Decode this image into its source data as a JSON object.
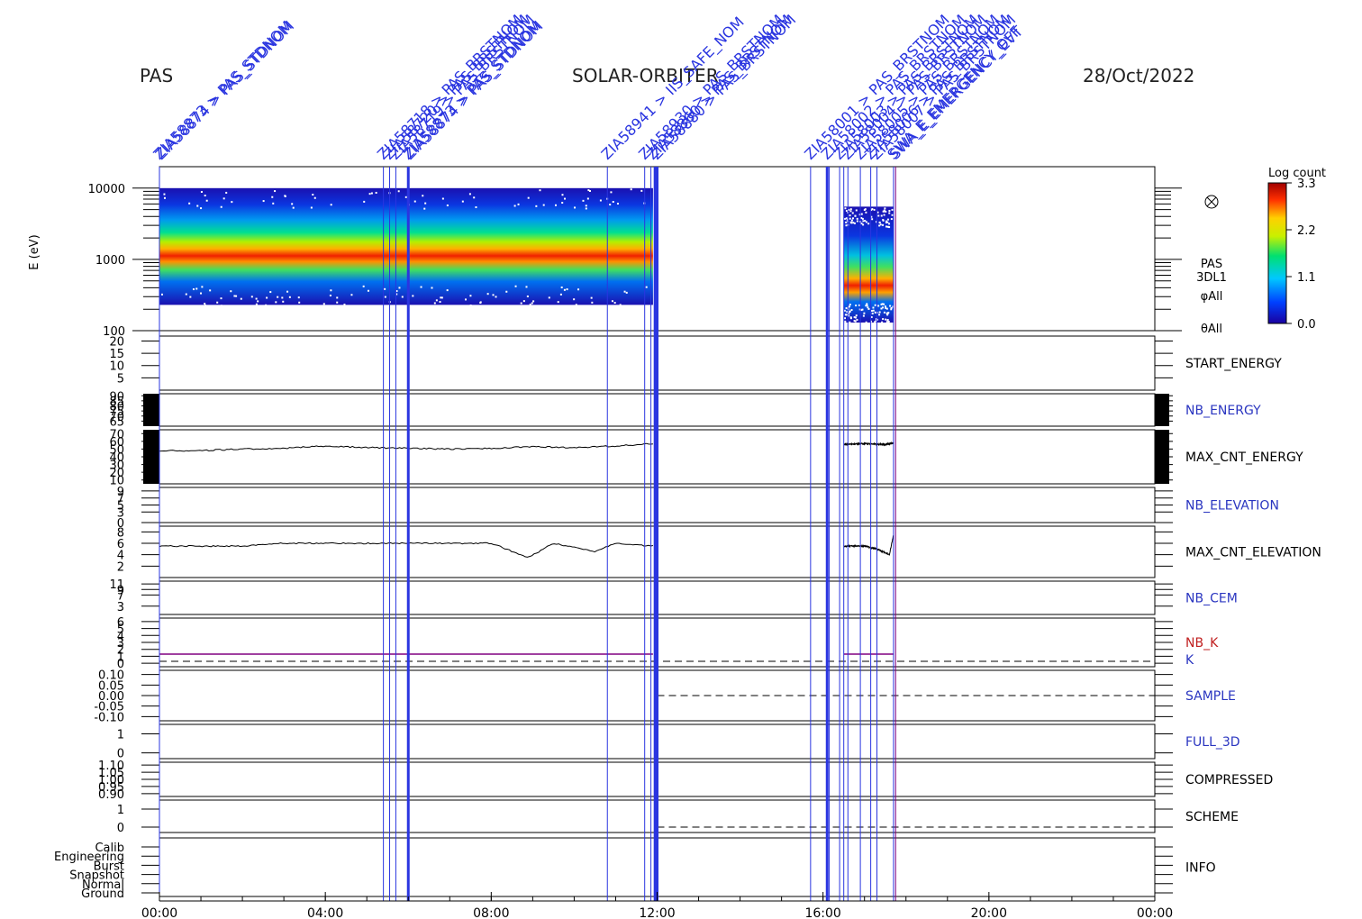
{
  "header": {
    "instrument": "PAS",
    "mission": "SOLAR-ORBITER",
    "date": "28/Oct/2022"
  },
  "chart_data": {
    "type": "heatmap",
    "title": "",
    "xlabel": "",
    "x_ticks": [
      "00:00",
      "04:00",
      "08:00",
      "12:00",
      "16:00",
      "20:00",
      "00:00"
    ],
    "x_range_hours": [
      0,
      24
    ],
    "spectrogram": {
      "ylabel": "E (eV)",
      "y_scale": "log",
      "ylim": [
        100,
        20000
      ],
      "y_ticks": [
        "10000",
        "1000",
        "100"
      ],
      "colorbar": {
        "title": "Log count",
        "ticks": [
          "3.3",
          "2.2",
          "1.1",
          "0.0"
        ],
        "range": [
          0.0,
          3.3
        ]
      },
      "side_labels": [
        "PAS",
        "3DL1",
        "φAll",
        "θAll"
      ],
      "data_intervals_hours": [
        [
          0.0,
          11.9
        ],
        [
          16.5,
          17.7
        ]
      ],
      "peak_energy_eV_approx": 1000,
      "coverage_energy_eV": [
        230,
        10000
      ]
    },
    "panels": [
      {
        "name": "START_ENERGY",
        "color": "#000000",
        "y_ticks": [
          "20",
          "15",
          "10",
          "5"
        ],
        "ylim": [
          0,
          22
        ]
      },
      {
        "name": "NB_ENERGY",
        "color": "#2a35c0",
        "y_ticks": [
          "90",
          "85",
          "80",
          "75",
          "70",
          "65"
        ],
        "ylim": [
          60,
          92
        ]
      },
      {
        "name": "MAX_CNT_ENERGY",
        "color": "#000000",
        "y_ticks": [
          "70",
          "60",
          "50",
          "40",
          "30",
          "20",
          "10"
        ],
        "ylim": [
          5,
          75
        ],
        "series": [
          {
            "x": [
              0.0,
              1.0,
              2.0,
              3.0,
              4.0,
              5.0,
              6.0,
              7.0,
              8.0,
              9.0,
              10.0,
              11.0,
              11.9
            ],
            "values": [
              48,
              48,
              50,
              51,
              54,
              52,
              51,
              50,
              51,
              53,
              52,
              54,
              57
            ]
          },
          {
            "x": [
              16.5,
              17.0,
              17.5,
              17.7
            ],
            "values": [
              56,
              57,
              56,
              58
            ]
          }
        ]
      },
      {
        "name": "NB_ELEVATION",
        "color": "#2a35c0",
        "y_ticks": [
          "9",
          "7",
          "5",
          "3",
          "0"
        ],
        "ylim": [
          0,
          10
        ]
      },
      {
        "name": "MAX_CNT_ELEVATION",
        "color": "#000000",
        "y_ticks": [
          "8",
          "6",
          "4",
          "2"
        ],
        "ylim": [
          0,
          9
        ],
        "series": [
          {
            "x": [
              0.0,
              2.0,
              3.0,
              5.0,
              6.0,
              8.0,
              8.9,
              9.5,
              10.5,
              11.0,
              11.9
            ],
            "values": [
              5.5,
              5.5,
              6.0,
              6.0,
              6.0,
              6.0,
              3.5,
              6.0,
              4.5,
              6.0,
              5.5
            ]
          },
          {
            "x": [
              16.5,
              17.0,
              17.3,
              17.6,
              17.7
            ],
            "values": [
              5.5,
              5.5,
              5.0,
              4.0,
              7.5
            ]
          }
        ]
      },
      {
        "name": "NB_CEM",
        "color": "#2a35c0",
        "y_ticks": [
          "11",
          "9",
          "7",
          "3"
        ],
        "ylim": [
          0,
          12
        ]
      },
      {
        "name": "NB_K",
        "color": "#c02020",
        "y_ticks": [
          "6",
          "5",
          "4",
          "3",
          "2",
          "1",
          "0"
        ],
        "ylim": [
          -0.5,
          6.5
        ]
      },
      {
        "name": "SAMPLE",
        "color": "#2a35c0",
        "y_ticks": [
          "0.10",
          "0.05",
          "0.00",
          "-0.05",
          "-0.10"
        ],
        "ylim": [
          -0.12,
          0.12
        ]
      },
      {
        "name": "FULL_3D",
        "color": "#2a35c0",
        "y_ticks": [
          "1",
          "0"
        ],
        "ylim": [
          -0.3,
          1.5
        ]
      },
      {
        "name": "COMPRESSED",
        "color": "#000000",
        "y_ticks": [
          "1.10",
          "1.05",
          "1.00",
          "0.95",
          "0.90"
        ],
        "ylim": [
          0.88,
          1.12
        ]
      },
      {
        "name": "SCHEME",
        "color": "#000000",
        "y_ticks": [
          "1",
          "0"
        ],
        "ylim": [
          -0.3,
          1.5
        ]
      },
      {
        "name": "INFO",
        "color": "#000000",
        "y_ticks": [
          "Calib",
          "Engineering",
          "Burst",
          "Snapshot",
          "Normal",
          "Ground"
        ],
        "ylim": [
          0,
          6
        ]
      }
    ],
    "k_label": "K",
    "event_lines_hours": [
      0.0,
      5.4,
      5.55,
      5.7,
      6.0,
      10.8,
      11.7,
      11.85,
      11.95,
      12.0,
      15.7,
      16.1,
      16.15,
      16.4,
      16.5,
      16.6,
      16.9,
      17.15,
      17.3,
      17.7,
      17.75
    ],
    "annotations": [
      {
        "x": 0.0,
        "text": "ZIA58873 > PAS_STDNOM",
        "color": "#2a35e0"
      },
      {
        "x": 0.05,
        "text": "ZIA58874 > PAS_STDNOM",
        "color": "#2a35e0"
      },
      {
        "x": 5.4,
        "text": "ZIA58718 > PAS_BRSTNOM",
        "color": "#2a35e0"
      },
      {
        "x": 5.55,
        "text": "ZIA58720 > PAS_BRSTNOM",
        "color": "#2a35e0"
      },
      {
        "x": 5.7,
        "text": "ZIA58719 > PAS_BRSTNOM",
        "color": "#2a35e0"
      },
      {
        "x": 6.0,
        "text": "ZIA58873 > PAS_STDNOM",
        "color": "#2a35e0"
      },
      {
        "x": 6.05,
        "text": "ZIA58874 > PAS_STDNOM",
        "color": "#2a35e0"
      },
      {
        "x": 10.8,
        "text": "ZIA58941 > IIS_SAFE_NOM",
        "color": "#2a35e0"
      },
      {
        "x": 11.7,
        "text": "ZIA58930 > PAS_BRSTNOM",
        "color": "#2a35e0"
      },
      {
        "x": 11.9,
        "text": "ZIA58860 > PAS_BRSTNOM",
        "color": "#2a35e0"
      },
      {
        "x": 12.0,
        "text": "ZIA58880 > PAS_BRSTNOM",
        "color": "#2a35e0"
      },
      {
        "x": 15.7,
        "text": "ZIA58001 > PAS_BRSTNOM",
        "color": "#2a35e0"
      },
      {
        "x": 16.1,
        "text": "ZIA58002 > PAS_BRSTNOM",
        "color": "#2a35e0"
      },
      {
        "x": 16.4,
        "text": "ZIA58003 > PAS_BRSTNOM",
        "color": "#2a35e0"
      },
      {
        "x": 16.6,
        "text": "ZIA58004 > PAS_BRSTNOM",
        "color": "#2a35e0"
      },
      {
        "x": 16.9,
        "text": "ZIA58005 > PAS_BRSTNOM",
        "color": "#2a35e0"
      },
      {
        "x": 17.15,
        "text": "ZIA58006 > PAS_BRSTNOM",
        "color": "#2a35e0"
      },
      {
        "x": 17.3,
        "text": "ZIA58007 > PAS_BRSTNOM",
        "color": "#2a35e0"
      },
      {
        "x": 17.7,
        "text": "SWA_E_EMERGENCY_OFF",
        "color": "#c02040"
      },
      {
        "x": 17.75,
        "text": "SWA_E_EMERGENCY_EVT",
        "color": "#c02040"
      }
    ]
  }
}
